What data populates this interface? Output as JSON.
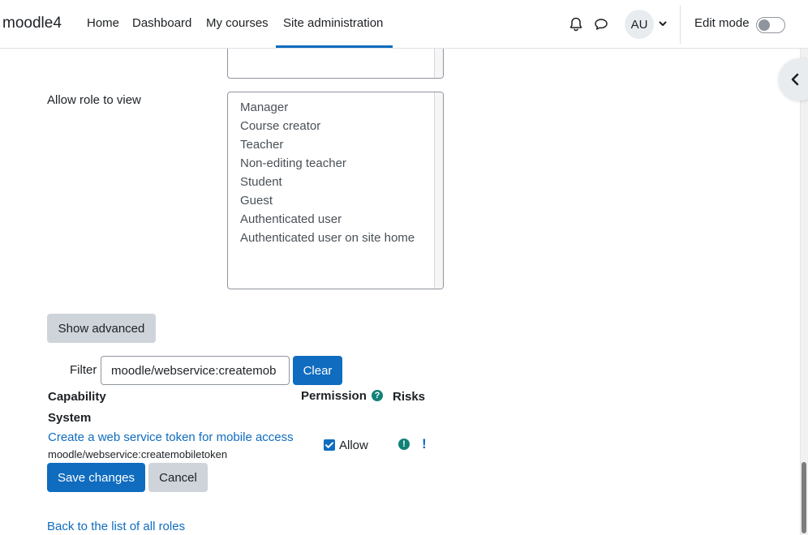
{
  "navbar": {
    "brand": "moodle4",
    "items": [
      {
        "label": "Home"
      },
      {
        "label": "Dashboard"
      },
      {
        "label": "My courses"
      },
      {
        "label": "Site administration"
      }
    ],
    "avatar_initials": "AU",
    "edit_mode_label": "Edit mode",
    "edit_mode_on": false
  },
  "form": {
    "allow_view_label": "Allow role to view",
    "roles": [
      "Manager",
      "Course creator",
      "Teacher",
      "Non-editing teacher",
      "Student",
      "Guest",
      "Authenticated user",
      "Authenticated user on site home"
    ],
    "show_advanced_label": "Show advanced"
  },
  "filter": {
    "label": "Filter",
    "value": "moodle/webservice:createmob",
    "clear_label": "Clear"
  },
  "table": {
    "headers": {
      "capability": "Capability",
      "permission": "Permission",
      "risks": "Risks"
    },
    "help_glyph": "?",
    "group": "System",
    "row": {
      "name": "Create a web service token for mobile access",
      "code": "moodle/webservice:createmobiletoken",
      "permission_label": "Allow",
      "checked": true
    }
  },
  "actions": {
    "save_label": "Save changes",
    "cancel_label": "Cancel",
    "back_link": "Back to the list of all roles"
  },
  "colors": {
    "primary": "#0f6cbf",
    "secondary_btn": "#ced4da",
    "help_icon": "#128178"
  }
}
